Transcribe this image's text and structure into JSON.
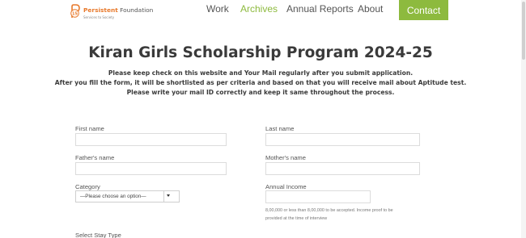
{
  "brand": {
    "logo_number": "15",
    "name_highlight": "Persistent",
    "name_rest": " Foundation",
    "tagline": "Services to Society"
  },
  "nav": {
    "items": [
      {
        "label": "Work",
        "active": false
      },
      {
        "label": "Archives",
        "active": true
      },
      {
        "label": "Annual Reports",
        "active": false
      },
      {
        "label": "About",
        "active": false
      }
    ],
    "contact_label": "Contact"
  },
  "colors": {
    "accent": "#8dba3e",
    "brand_orange": "#e8792b"
  },
  "page": {
    "title": "Kiran Girls Scholarship Program 2024-25",
    "notices": [
      "Please keep check on this website and Your Mail regularly after you submit application.",
      "After you fill the form, it will be shortlisted as per criteria and based on that you will receive mail about Aptitude test.",
      "Please write your mail ID correctly and keep it same throughout the process."
    ]
  },
  "form": {
    "first_name": {
      "label": "First name",
      "value": ""
    },
    "last_name": {
      "label": "Last name",
      "value": ""
    },
    "fathers_name": {
      "label": "Father's name",
      "value": ""
    },
    "mothers_name": {
      "label": "Mother's name",
      "value": ""
    },
    "category": {
      "label": "Category",
      "selected": "—Please choose an option—"
    },
    "annual_income": {
      "label": "Annual Income",
      "value": "",
      "help_line1": "8,00,000 or less than 8,00,000 to be accepted. Income proof to be",
      "help_line2": "provided at the time of interview"
    },
    "stay_type": {
      "label": "Select Stay Type"
    }
  }
}
